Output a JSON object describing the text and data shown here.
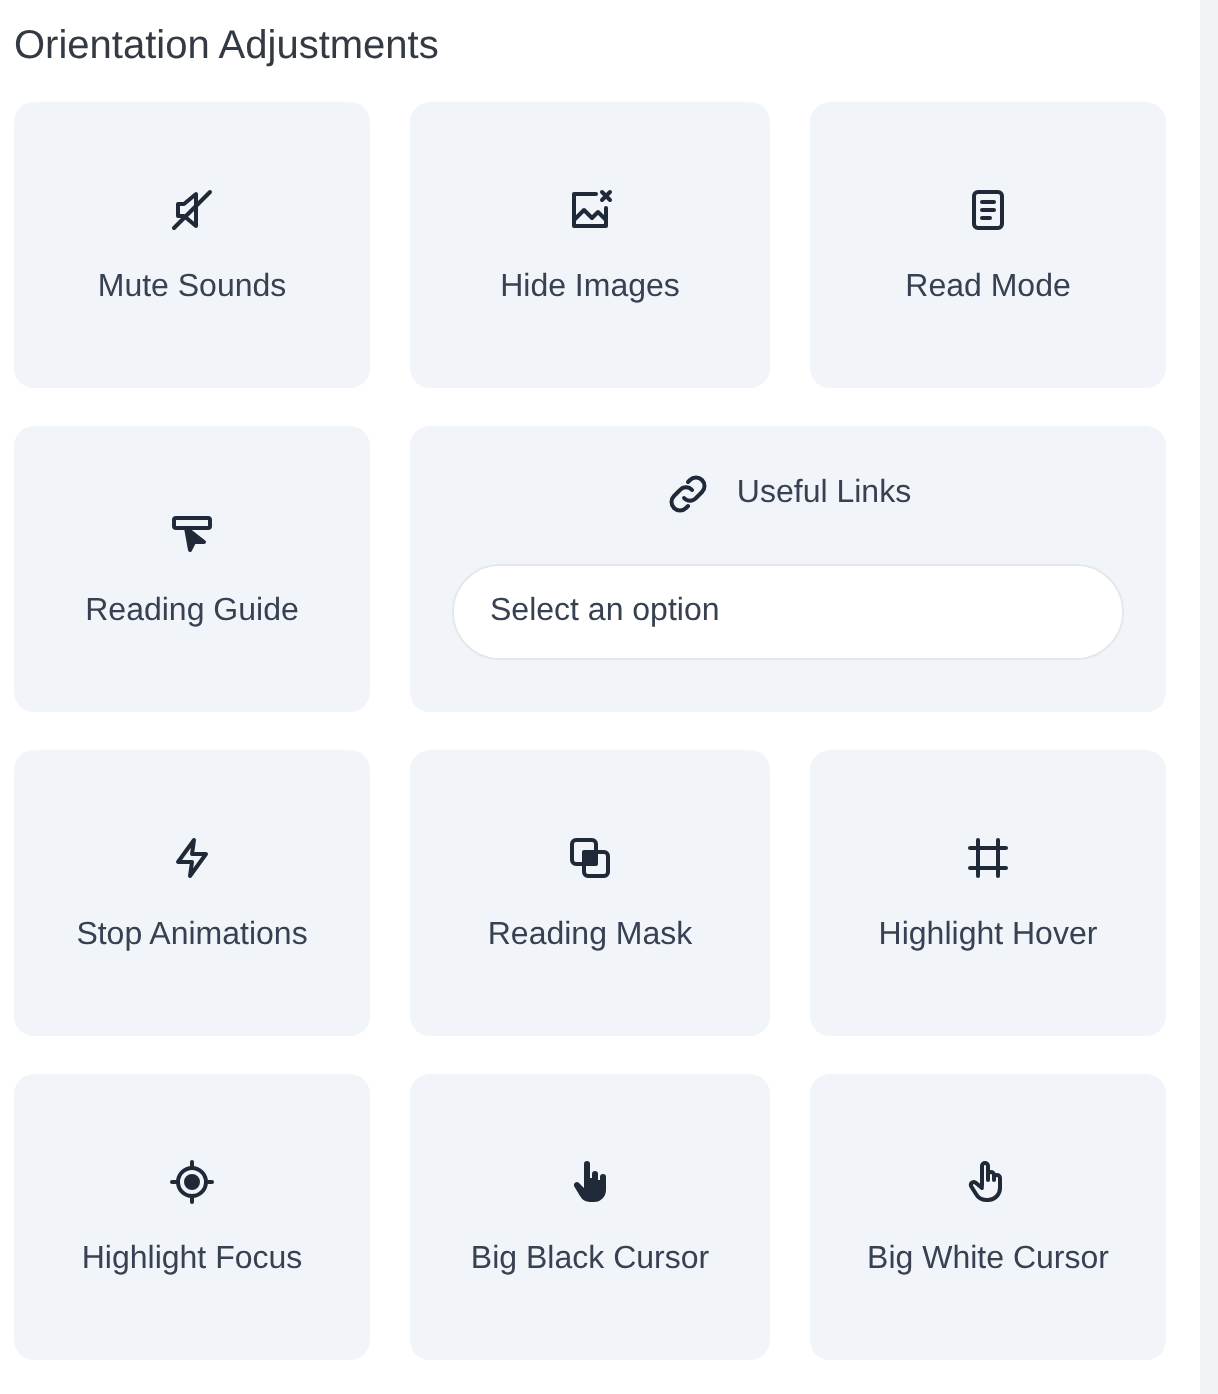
{
  "title": "Orientation Adjustments",
  "items": [
    {
      "kind": "toggle",
      "label": "Mute Sounds"
    },
    {
      "kind": "toggle",
      "label": "Hide Images"
    },
    {
      "kind": "toggle",
      "label": "Read Mode"
    },
    {
      "kind": "toggle",
      "label": "Reading Guide"
    },
    {
      "kind": "dropdown",
      "label": "Useful Links",
      "placeholder": "Select an option"
    },
    {
      "kind": "toggle",
      "label": "Stop Animations"
    },
    {
      "kind": "toggle",
      "label": "Reading Mask"
    },
    {
      "kind": "toggle",
      "label": "Highlight Hover"
    },
    {
      "kind": "toggle",
      "label": "Highlight Focus"
    },
    {
      "kind": "toggle",
      "label": "Big Black Cursor"
    },
    {
      "kind": "toggle",
      "label": "Big White Cursor"
    }
  ]
}
